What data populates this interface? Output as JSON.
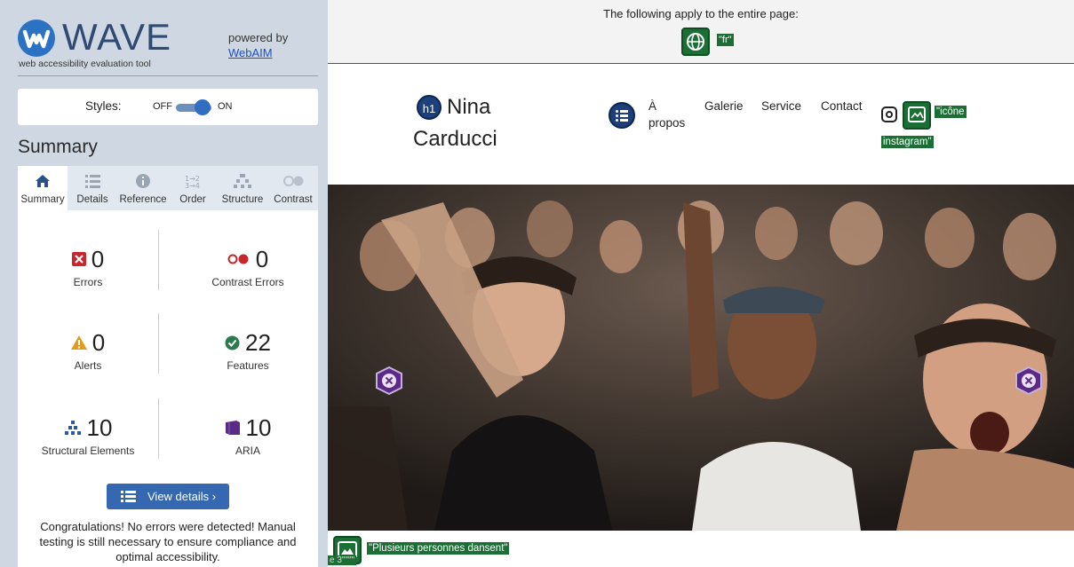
{
  "wave": {
    "title": "WAVE",
    "subtitle": "web accessibility evaluation tool",
    "powered_by": "powered by",
    "webaim_link": "WebAIM"
  },
  "styles": {
    "label": "Styles:",
    "off": "OFF",
    "on": "ON",
    "state": "on"
  },
  "summary_heading": "Summary",
  "tabs": [
    {
      "label": "Summary",
      "icon": "home-icon",
      "active": true
    },
    {
      "label": "Details",
      "icon": "list-icon",
      "active": false
    },
    {
      "label": "Reference",
      "icon": "info-icon",
      "active": false
    },
    {
      "label": "Order",
      "icon": "order-icon",
      "active": false
    },
    {
      "label": "Structure",
      "icon": "structure-icon",
      "active": false
    },
    {
      "label": "Contrast",
      "icon": "contrast-icon",
      "active": false
    }
  ],
  "stats": {
    "errors": {
      "count": "0",
      "label": "Errors",
      "color": "#c8262d"
    },
    "contrast_errors": {
      "count": "0",
      "label": "Contrast Errors",
      "color": "#c8262d"
    },
    "alerts": {
      "count": "0",
      "label": "Alerts",
      "color": "#e39b1a"
    },
    "features": {
      "count": "22",
      "label": "Features",
      "color": "#2b7a4b"
    },
    "structural": {
      "count": "10",
      "label": "Structural Elements",
      "color": "#2c5aa0"
    },
    "aria": {
      "count": "10",
      "label": "ARIA",
      "color": "#5b2a86"
    }
  },
  "view_details": "View details ›",
  "congrats": "Congratulations! No errors were detected! Manual testing is still necessary to ensure compliance and optimal accessibility.",
  "page": {
    "doc_note": "The following apply to the entire page:",
    "lang_tag": "\"fr\"",
    "h1_badge": "h1",
    "site_title_1": "Nina",
    "site_title_2": "Carducci",
    "nav": [
      "À propos",
      "Galerie",
      "Service",
      "Contact"
    ],
    "insta_alt_1": "\"icône",
    "insta_alt_2": "instagram\"",
    "img_alt": "\"Plusieurs personnes dansent\"",
    "img_alt2": "e 3\"\"\"\""
  }
}
